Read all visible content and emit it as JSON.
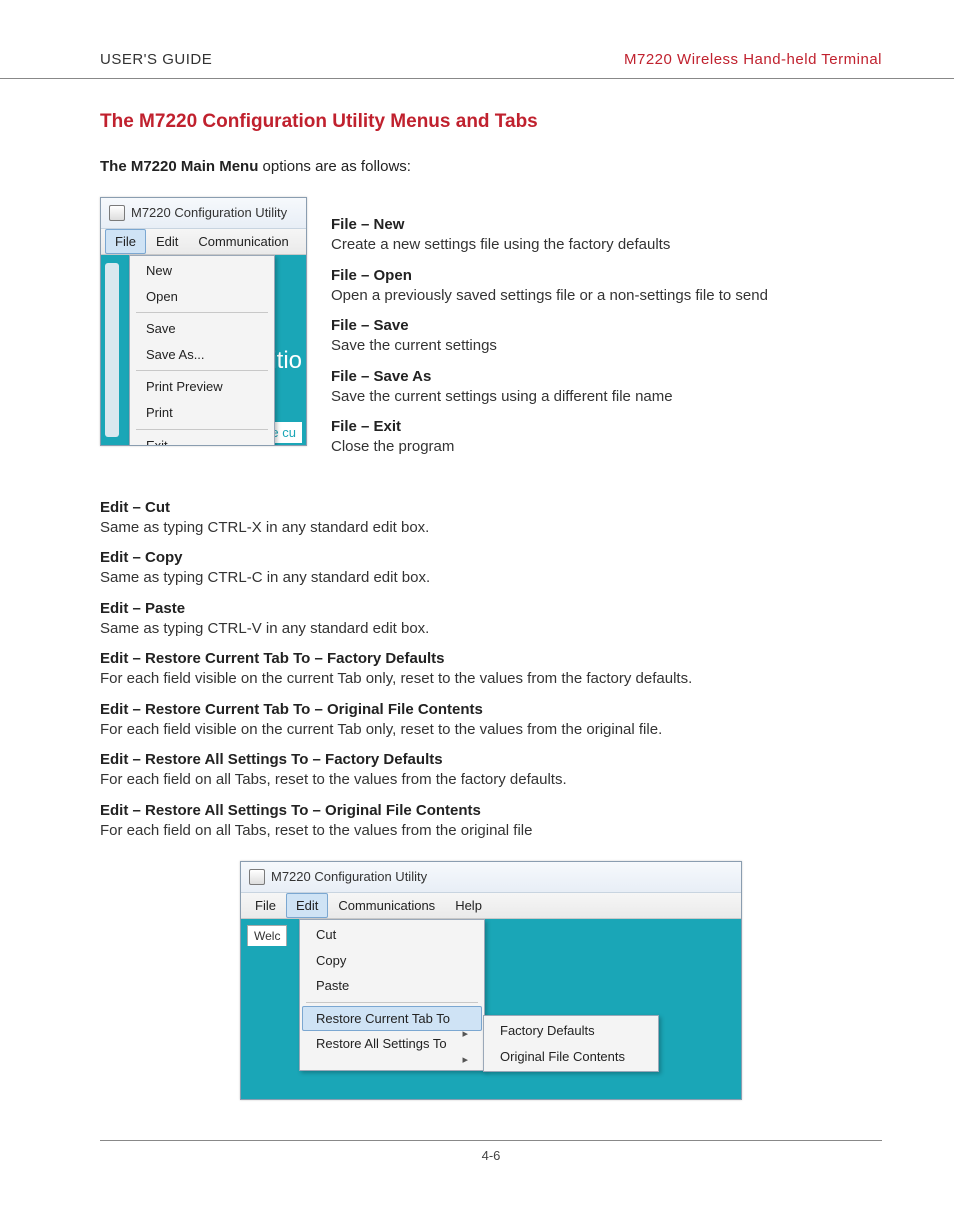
{
  "header": {
    "left": "USER'S GUIDE",
    "right": "M7220 Wireless Hand-held Terminal"
  },
  "section_title": "The M7220 Configuration Utility Menus and Tabs",
  "intro_bold": "The M7220 Main Menu",
  "intro_rest": " options are as follows:",
  "screenshot1": {
    "title": "M7220 Configuration Utility",
    "menubar": [
      "File",
      "Edit",
      "Communication"
    ],
    "dropdown": [
      "New",
      "Open",
      "Save",
      "Save As...",
      "Print Preview",
      "Print",
      "Exit"
    ],
    "bg_frag1": "itio",
    "bg_frag2": "Retrieve cu"
  },
  "file_items": [
    {
      "t": "File – New",
      "d": "Create a new settings file using the factory defaults"
    },
    {
      "t": "File – Open",
      "d": "Open a previously saved settings file or a non-settings file to send"
    },
    {
      "t": "File – Save",
      "d": "Save the current settings"
    },
    {
      "t": "File – Save As",
      "d": "Save the current settings using a different file name"
    },
    {
      "t": "File – Exit",
      "d": "Close the program"
    }
  ],
  "edit_items": [
    {
      "t": "Edit – Cut",
      "d": "Same as typing CTRL-X in any standard edit box."
    },
    {
      "t": "Edit – Copy",
      "d": "Same as typing CTRL-C in any standard edit box."
    },
    {
      "t": "Edit – Paste",
      "d": "Same as typing CTRL-V in any standard edit box."
    },
    {
      "t": "Edit – Restore Current Tab To – Factory Defaults",
      "d": "For each field visible on the current Tab only, reset to the values from the factory defaults."
    },
    {
      "t": "Edit – Restore Current Tab To – Original File Contents",
      "d": "For each field visible on the current Tab only, reset to the values from the original file."
    },
    {
      "t": "Edit – Restore All Settings To – Factory Defaults",
      "d": "For each field on all Tabs, reset to the values from the factory defaults."
    },
    {
      "t": "Edit – Restore All Settings To – Original File Contents",
      "d": "For each field on all Tabs, reset to the values from the original file"
    }
  ],
  "screenshot2": {
    "title": "M7220 Configuration Utility",
    "menubar": [
      "File",
      "Edit",
      "Communications",
      "Help"
    ],
    "tab": "Welc",
    "dropdown": [
      "Cut",
      "Copy",
      "Paste",
      "Restore Current Tab To",
      "Restore All Settings To"
    ],
    "submenu": [
      "Factory Defaults",
      "Original File Contents"
    ]
  },
  "page_number": "4-6"
}
